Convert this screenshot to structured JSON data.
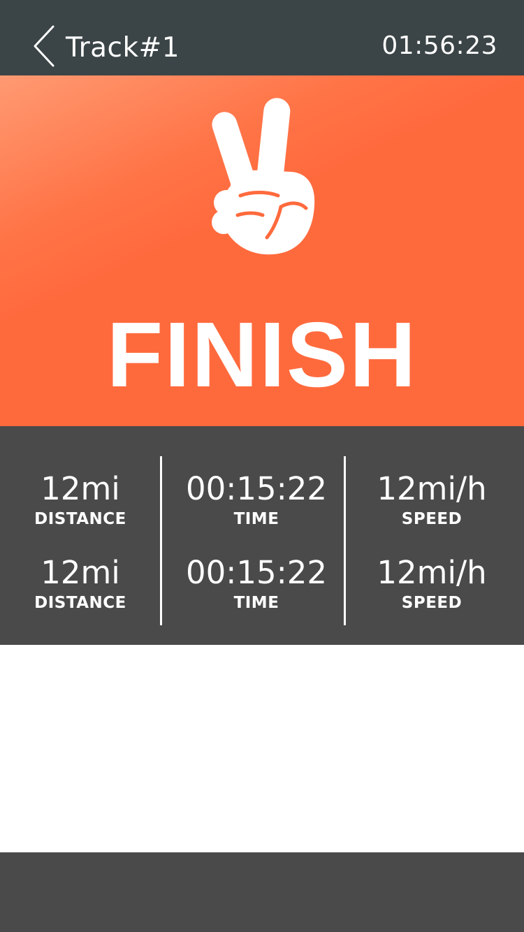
{
  "header": {
    "back_icon": "chevron-left-icon",
    "title": "Track#1",
    "clock": "01:56:23"
  },
  "hero": {
    "icon": "peace-hand-icon",
    "title": "FINISH",
    "colors": {
      "accent": "#ff6a3d",
      "accent_light": "#ff9a72"
    }
  },
  "stats": {
    "rows": [
      {
        "distance": {
          "value": "12mi",
          "label": "DISTANCE"
        },
        "time": {
          "value": "00:15:22",
          "label": "TIME"
        },
        "speed": {
          "value": "12mi/h",
          "label": "SPEED"
        }
      },
      {
        "distance": {
          "value": "12mi",
          "label": "DISTANCE"
        },
        "time": {
          "value": "00:15:22",
          "label": "TIME"
        },
        "speed": {
          "value": "12mi/h",
          "label": "SPEED"
        }
      }
    ]
  },
  "theme": {
    "header_bg": "#3b4447",
    "stats_bg": "#4a4a4a",
    "text": "#ffffff"
  }
}
